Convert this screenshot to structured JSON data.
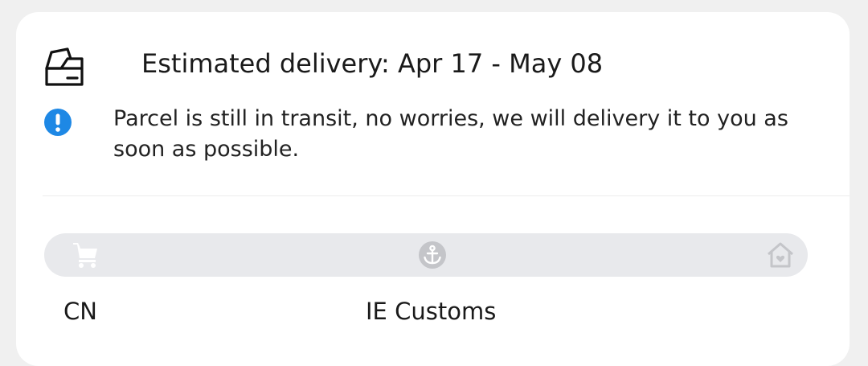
{
  "delivery": {
    "icon": "package-box-icon",
    "estimated_text": "Estimated delivery: Apr 17 - May 08"
  },
  "notice": {
    "icon": "info-exclamation-icon",
    "icon_color": "#1e88e5",
    "message": "Parcel is still in transit, no worries, we will delivery it to you as soon as possible."
  },
  "tracking": {
    "stages": [
      {
        "icon": "shopping-cart-icon",
        "label": "CN"
      },
      {
        "icon": "anchor-icon",
        "label": "IE Customs"
      },
      {
        "icon": "home-icon",
        "label": ""
      }
    ],
    "bar_color": "#e8e9ec",
    "icon_color": "#c4c5c9"
  }
}
